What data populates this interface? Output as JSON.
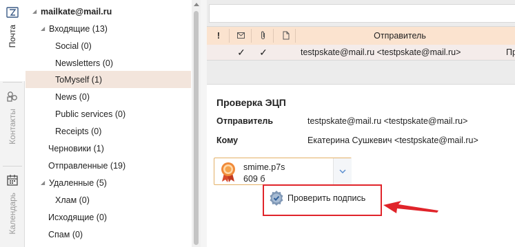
{
  "rail": {
    "tabs": [
      {
        "label": "Почта",
        "icon": "mail-icon",
        "active": true
      },
      {
        "label": "Контакты",
        "icon": "contacts-icon",
        "active": false
      },
      {
        "label": "Календарь",
        "icon": "calendar-icon",
        "active": false
      }
    ]
  },
  "tree": {
    "account": "mailkate@mail.ru",
    "folders": [
      {
        "label": "Входящие (13)"
      },
      {
        "label": "Social (0)"
      },
      {
        "label": "Newsletters (0)"
      },
      {
        "label": "ToMyself (1)",
        "selected": true
      },
      {
        "label": "News (0)"
      },
      {
        "label": "Public services (0)"
      },
      {
        "label": "Receipts (0)"
      },
      {
        "label": "Черновики (1)"
      },
      {
        "label": "Отправленные (19)"
      },
      {
        "label": "Удаленные (5)"
      },
      {
        "label": "Хлам (0)"
      },
      {
        "label": "Исходящие (0)"
      },
      {
        "label": "Спам (0)"
      }
    ]
  },
  "messages": {
    "columns": {
      "flag": "!",
      "sender": "Отправитель"
    },
    "rows": [
      {
        "read_check": "✓",
        "attach_check": "✓",
        "sender": "testpskate@mail.ru <testpskate@mail.ru>",
        "subject_fragment": "Пр"
      }
    ]
  },
  "preview": {
    "title": "Проверка ЭЦП",
    "sender_label": "Отправитель",
    "sender_value": "testpskate@mail.ru <testpskate@mail.ru>",
    "to_label": "Кому",
    "to_value": "Екатерина Сушкевич <testpskate@mail.ru>",
    "attachment": {
      "name": "smime.p7s",
      "size": "609 б",
      "icon": "certificate-icon"
    },
    "verify_button": "Проверить подпись"
  },
  "colors": {
    "header_bg": "#fbe3cf",
    "selected_bg": "#f3e5dc",
    "highlight_red": "#e0242a",
    "attachment_border": "#e3b066"
  }
}
